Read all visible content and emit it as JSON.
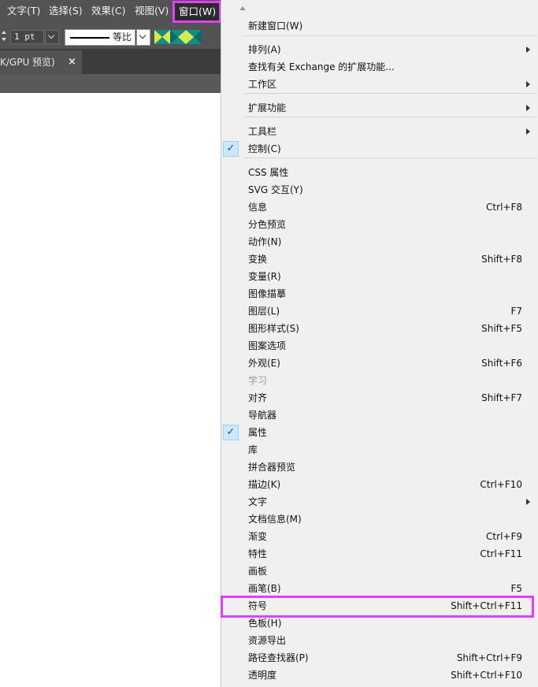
{
  "menubar": {
    "items": [
      {
        "label": "文字(T)"
      },
      {
        "label": "选择(S)"
      },
      {
        "label": "效果(C)"
      },
      {
        "label": "视图(V)"
      },
      {
        "label": "窗口(W)"
      }
    ]
  },
  "toolbar": {
    "stroke_weight": "1 pt",
    "stroke_profile": "等比"
  },
  "document_tab": {
    "title": "K/GPU 预览)",
    "close": "×"
  },
  "window_menu": {
    "items": [
      {
        "label": "新建窗口(W)"
      },
      {
        "label": "排列(A)",
        "submenu": true
      },
      {
        "label": "查找有关 Exchange 的扩展功能..."
      },
      {
        "label": "工作区",
        "submenu": true
      },
      {
        "label": "扩展功能",
        "submenu": true
      },
      {
        "label": "工具栏",
        "submenu": true
      },
      {
        "label": "控制(C)",
        "checked": true
      },
      {
        "label": "CSS 属性"
      },
      {
        "label": "SVG 交互(Y)"
      },
      {
        "label": "信息",
        "shortcut": "Ctrl+F8"
      },
      {
        "label": "分色预览"
      },
      {
        "label": "动作(N)"
      },
      {
        "label": "变换",
        "shortcut": "Shift+F8"
      },
      {
        "label": "变量(R)"
      },
      {
        "label": "图像描摹"
      },
      {
        "label": "图层(L)",
        "shortcut": "F7"
      },
      {
        "label": "图形样式(S)",
        "shortcut": "Shift+F5"
      },
      {
        "label": "图案选项"
      },
      {
        "label": "外观(E)",
        "shortcut": "Shift+F6"
      },
      {
        "label": "学习",
        "disabled": true
      },
      {
        "label": "对齐",
        "shortcut": "Shift+F7"
      },
      {
        "label": "导航器"
      },
      {
        "label": "属性",
        "checked": true
      },
      {
        "label": "库"
      },
      {
        "label": "拼合器预览"
      },
      {
        "label": "描边(K)",
        "shortcut": "Ctrl+F10"
      },
      {
        "label": "文字",
        "submenu": true
      },
      {
        "label": "文档信息(M)"
      },
      {
        "label": "渐变",
        "shortcut": "Ctrl+F9"
      },
      {
        "label": "特性",
        "shortcut": "Ctrl+F11"
      },
      {
        "label": "画板"
      },
      {
        "label": "画笔(B)",
        "shortcut": "F5"
      },
      {
        "label": "符号",
        "shortcut": "Shift+Ctrl+F11"
      },
      {
        "label": "色板(H)"
      },
      {
        "label": "资源导出"
      },
      {
        "label": "路径查找器(P)",
        "shortcut": "Shift+Ctrl+F9"
      },
      {
        "label": "透明度",
        "shortcut": "Shift+Ctrl+F10"
      }
    ]
  },
  "colors": {
    "highlight": "#e040fb",
    "check_bg": "#cce8ff",
    "menubar_bg": "#535353"
  }
}
